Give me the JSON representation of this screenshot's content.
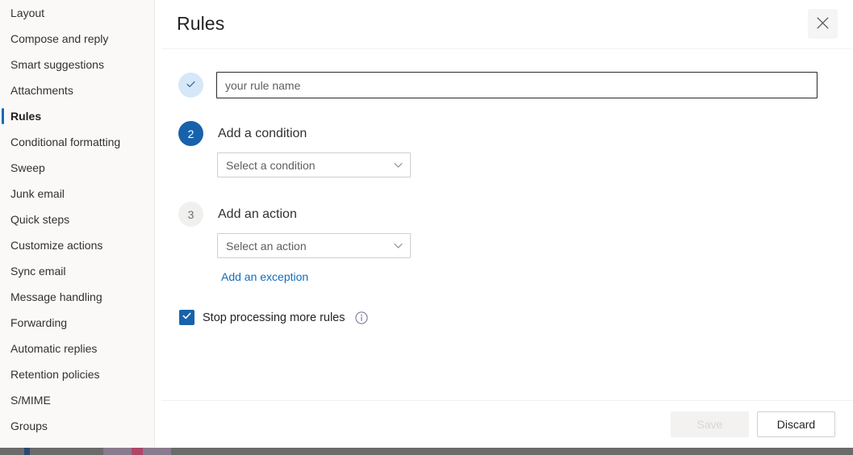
{
  "sidebar": {
    "items": [
      {
        "label": "Layout",
        "selected": false
      },
      {
        "label": "Compose and reply",
        "selected": false
      },
      {
        "label": "Smart suggestions",
        "selected": false
      },
      {
        "label": "Attachments",
        "selected": false
      },
      {
        "label": "Rules",
        "selected": true
      },
      {
        "label": "Conditional formatting",
        "selected": false
      },
      {
        "label": "Sweep",
        "selected": false
      },
      {
        "label": "Junk email",
        "selected": false
      },
      {
        "label": "Quick steps",
        "selected": false
      },
      {
        "label": "Customize actions",
        "selected": false
      },
      {
        "label": "Sync email",
        "selected": false
      },
      {
        "label": "Message handling",
        "selected": false
      },
      {
        "label": "Forwarding",
        "selected": false
      },
      {
        "label": "Automatic replies",
        "selected": false
      },
      {
        "label": "Retention policies",
        "selected": false
      },
      {
        "label": "S/MIME",
        "selected": false
      },
      {
        "label": "Groups",
        "selected": false
      }
    ]
  },
  "header": {
    "title": "Rules",
    "close_icon": "close-icon"
  },
  "form": {
    "step1": {
      "badge": "check-icon",
      "badge_state": "completed",
      "name_input_placeholder": "your rule name",
      "name_input_value": ""
    },
    "step2": {
      "badge": "2",
      "badge_state": "active",
      "heading": "Add a condition",
      "dropdown_value": "Select a condition",
      "dropdown_icon": "chevron-down-icon"
    },
    "step3": {
      "badge": "3",
      "badge_state": "idle",
      "heading": "Add an action",
      "dropdown_value": "Select an action",
      "dropdown_icon": "chevron-down-icon",
      "exception_link": "Add an exception"
    },
    "stop_processing": {
      "label": "Stop processing more rules",
      "checked": true,
      "info_icon": "info-icon"
    }
  },
  "footer": {
    "save_label": "Save",
    "save_disabled": true,
    "discard_label": "Discard"
  },
  "colors": {
    "accent": "#1862ab",
    "link": "#116dbe",
    "badge_done_bg": "#d6e8f8",
    "badge_idle_bg": "#f0f0ef",
    "sidebar_bg": "#faf9f8",
    "save_disabled_bg": "#f3f2f1"
  }
}
